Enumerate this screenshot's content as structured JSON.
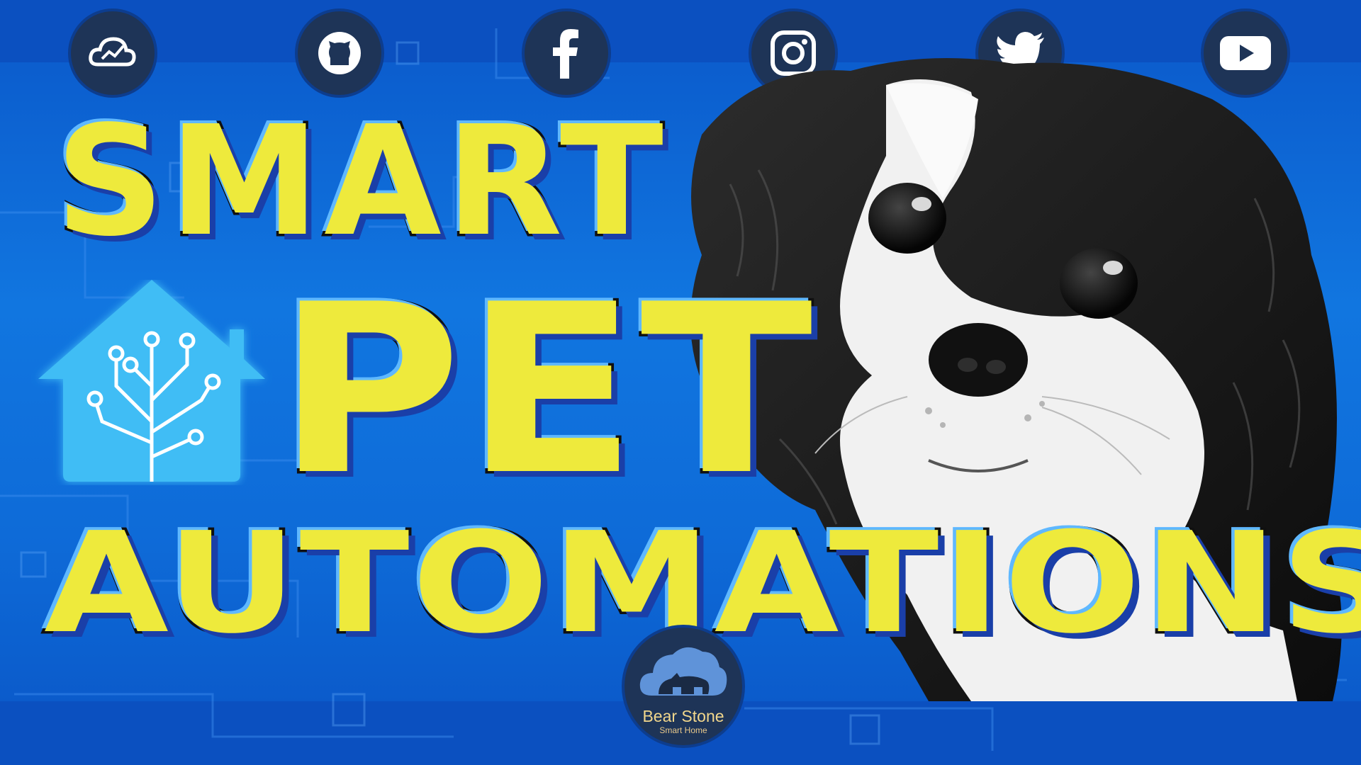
{
  "title": {
    "line1": "SMART",
    "line2": "PET",
    "line3": "AUTOMATIONS"
  },
  "social_icons": [
    "cloud-chart-icon",
    "github-icon",
    "facebook-icon",
    "instagram-icon",
    "twitter-icon",
    "youtube-icon"
  ],
  "brand": {
    "name": "Bear Stone",
    "tagline": "Smart Home"
  },
  "colors": {
    "background": "#1176e0",
    "title_fill": "#eeea3c",
    "icon_circle": "#1e3457",
    "home_logo": "#41bdf5"
  }
}
